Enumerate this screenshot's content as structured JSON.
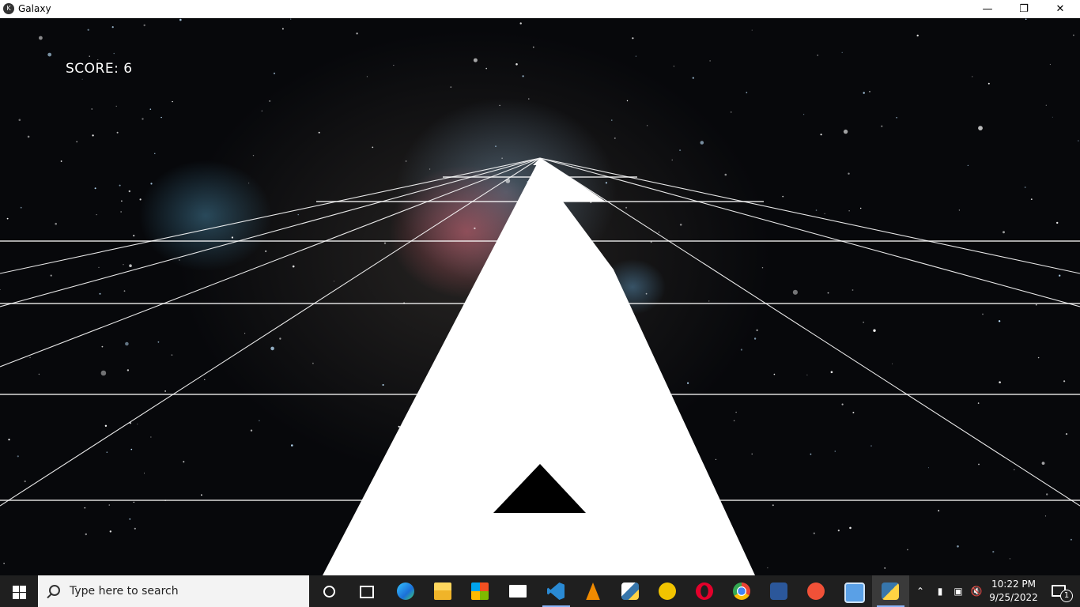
{
  "window": {
    "title": "Galaxy",
    "app_icon": "kivy-icon",
    "minimize_icon": "minimize-icon",
    "maximize_icon": "restore-icon",
    "close_icon": "close-icon"
  },
  "game": {
    "score_text": "SCORE: 6",
    "colors": {
      "track": "#ffffff",
      "ship": "#000000",
      "grid": "#ffffff"
    }
  },
  "taskbar": {
    "search_placeholder": "Type here to search",
    "pinned": [
      "cortana-icon",
      "task-view-icon",
      "edge-icon",
      "file-explorer-icon",
      "microsoft-store-icon",
      "mail-icon",
      "vscode-icon",
      "vlc-icon",
      "python-idle-icon",
      "archicad-icon",
      "opera-icon",
      "chrome-icon",
      "word-icon",
      "swift-icon",
      "control-panel-icon",
      "python-app-icon"
    ],
    "tray": {
      "time": "10:22 PM",
      "date": "9/25/2022",
      "notification_count": "1"
    }
  }
}
